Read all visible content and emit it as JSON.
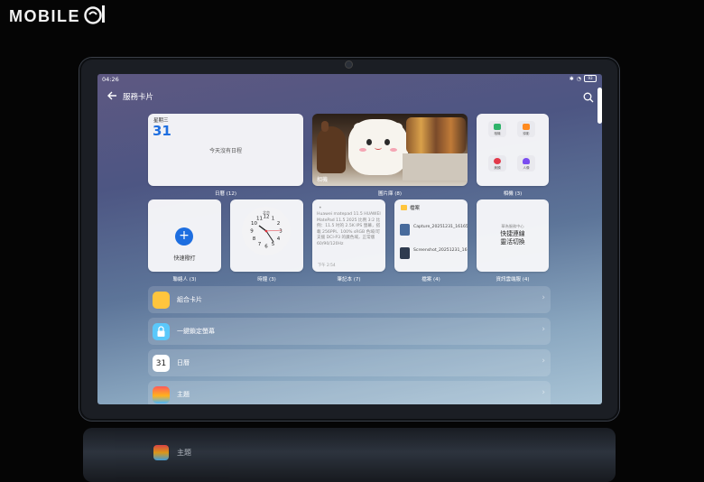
{
  "watermark": {
    "brand": "MOBILE"
  },
  "status_bar": {
    "time": "04:26",
    "battery": "93"
  },
  "header": {
    "title": "服務卡片"
  },
  "cards": {
    "calendar": {
      "weekday": "星期三",
      "date": "31",
      "empty_text": "今天沒有日程",
      "label": "日曆 (12)"
    },
    "gallery_photo": {
      "caption": "相機",
      "label": "圖片庫 (8)"
    },
    "camera": {
      "label": "相機 (3)",
      "tiles": [
        {
          "text": "相機",
          "color": "#2fb36a"
        },
        {
          "text": "錄影",
          "color": "#ff8a1f"
        },
        {
          "text": "美顏",
          "color": "#e2394a"
        },
        {
          "text": "人像",
          "color": "#7a4df0"
        }
      ]
    },
    "contacts": {
      "text": "快速撥打",
      "label": "聯絡人 (3)"
    },
    "clock": {
      "label": "時鐘 (3)",
      "city": "北京"
    },
    "notes": {
      "body": "Huawei matepad 11.5 HUAWEI MatePad 11.5 2025 比例 3:2 比例：11.5 吋的 2.5K IPS 螢幕，搭載 256PPI、100% sRGB 色域/可支援 DCI-P3 的廣色域，正常版 60/90/120Hz",
      "time": "下午 2:54",
      "label": "筆記本 (7)"
    },
    "files": {
      "title": "檔案",
      "items": [
        "Capture_20251231_161656.jpg",
        "Screenshot_20251231_161639_co..."
      ],
      "label": "檔案 (4)"
    },
    "huawei": {
      "small": "華為服務中心",
      "big_line1": "快捷連線",
      "big_line2": "靈活切換",
      "label": "資訊雲端服 (4)"
    }
  },
  "list": [
    {
      "label": "組合卡片",
      "icon": "combo-card-icon",
      "color": "#ffc53d"
    },
    {
      "label": "一鍵鎖定螢幕",
      "icon": "lock-icon",
      "color": "#5ac8fa"
    },
    {
      "label": "日曆",
      "icon": "calendar-icon",
      "color": "#ffffff",
      "date": "31"
    },
    {
      "label": "主題",
      "icon": "theme-icon",
      "color": "#ff5a5a"
    }
  ],
  "reflection": {
    "label": "主題"
  }
}
